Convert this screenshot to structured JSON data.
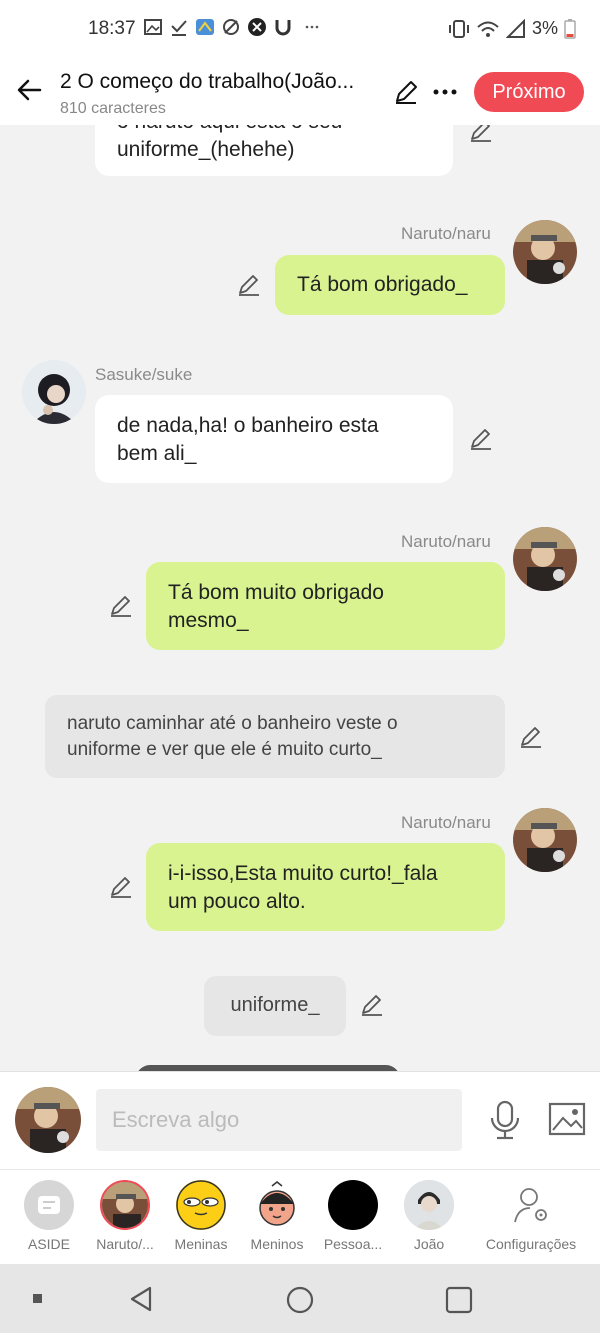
{
  "status": {
    "time": "18:37",
    "battery": "3%"
  },
  "header": {
    "title": "2 O começo do trabalho(João...",
    "subtitle": "810 caracteres",
    "next_label": "Próximo"
  },
  "messages": {
    "m0_line1": "o naruto aqui esta o seu",
    "m0_line2": "uniforme_(hehehe)",
    "m1_name": "Naruto/naru",
    "m1_text": "Tá bom obrigado_",
    "m2_name": "Sasuke/suke",
    "m2_line1": "de nada,ha! o banheiro esta",
    "m2_line2": "bem ali_",
    "m3_name": "Naruto/naru",
    "m3_line1": "Tá bom muito obrigado",
    "m3_line2": "mesmo_",
    "m4_line1": "naruto caminhar até o banheiro veste o",
    "m4_line2": "uniforme e ver que ele é muito curto_",
    "m5_name": "Naruto/naru",
    "m5_line1": "i-i-isso,Esta muito curto!_fala",
    "m5_line2": "um pouco alto.",
    "m6_text": "uniforme_"
  },
  "composer": {
    "placeholder": "Escreva algo"
  },
  "characters": [
    {
      "label": "ASIDE"
    },
    {
      "label": "Naruto/..."
    },
    {
      "label": "Meninas"
    },
    {
      "label": "Meninos"
    },
    {
      "label": "Pessoa..."
    },
    {
      "label": "João"
    },
    {
      "label": "Configurações"
    }
  ],
  "colors": {
    "accent": "#f04a55",
    "bubble_green": "#d8f38f",
    "bubble_white": "#ffffff"
  }
}
